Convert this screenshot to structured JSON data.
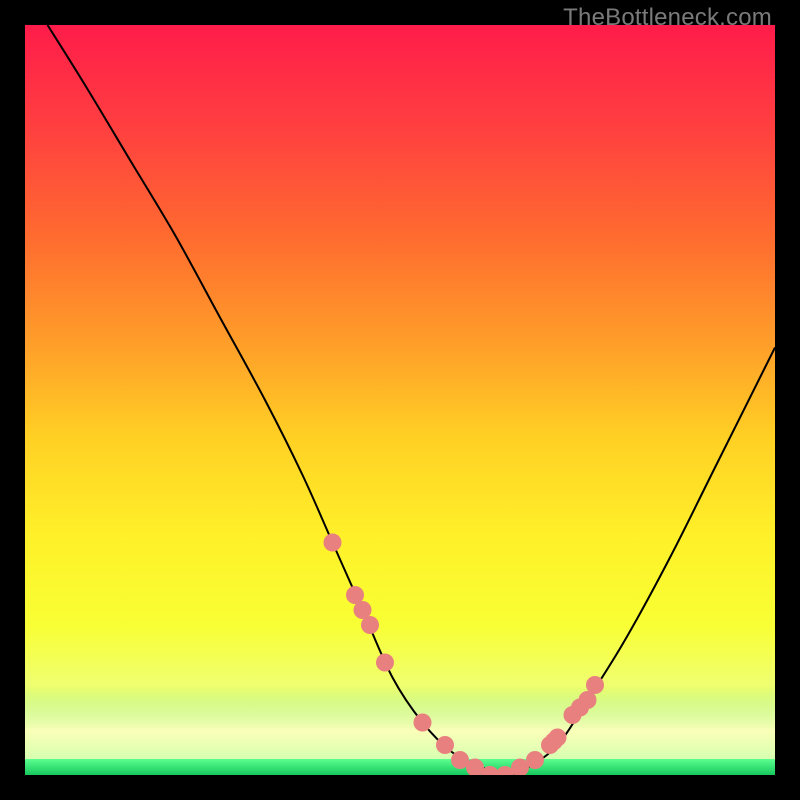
{
  "attribution": "TheBottleneck.com",
  "chart_data": {
    "type": "line",
    "title": "",
    "xlabel": "",
    "ylabel": "",
    "xlim": [
      0,
      100
    ],
    "ylim": [
      0,
      100
    ],
    "grid": false,
    "legend": false,
    "series": [
      {
        "name": "curve",
        "x": [
          3,
          8,
          14,
          20,
          26,
          32,
          37,
          41,
          45,
          49,
          53,
          57,
          61,
          64,
          67,
          71,
          75,
          80,
          86,
          92,
          100
        ],
        "y": [
          100,
          92,
          82,
          72,
          61,
          50,
          40,
          31,
          22,
          13,
          7,
          3,
          1,
          0,
          1,
          4,
          10,
          18,
          29,
          41,
          57
        ]
      }
    ],
    "markers": [
      {
        "name": "low-band-points",
        "x": [
          41,
          44,
          45,
          46,
          48,
          53,
          56,
          58,
          60,
          62,
          64,
          66,
          68,
          70,
          70.5,
          71,
          73,
          74,
          75,
          76
        ],
        "y": [
          31,
          24,
          22,
          20,
          15,
          7,
          4,
          2,
          1,
          0,
          0,
          1,
          2,
          4,
          4.5,
          5,
          8,
          9,
          10,
          12
        ]
      }
    ],
    "background_gradient": {
      "top": "#ff1c4a",
      "mid": "#ffd024",
      "bottom": "#28e070"
    }
  }
}
